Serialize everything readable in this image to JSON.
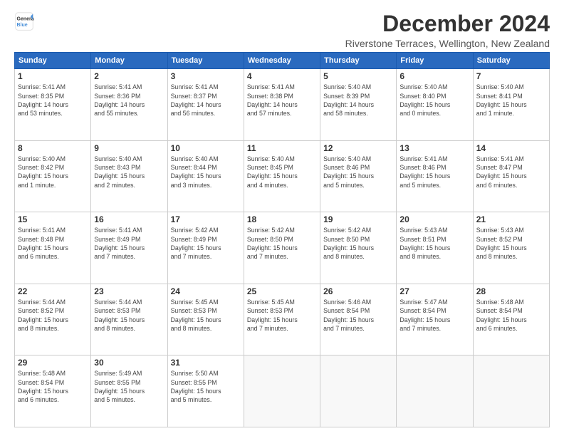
{
  "logo": {
    "line1": "General",
    "line2": "Blue"
  },
  "title": "December 2024",
  "subtitle": "Riverstone Terraces, Wellington, New Zealand",
  "weekdays": [
    "Sunday",
    "Monday",
    "Tuesday",
    "Wednesday",
    "Thursday",
    "Friday",
    "Saturday"
  ],
  "weeks": [
    [
      {
        "day": "1",
        "info": "Sunrise: 5:41 AM\nSunset: 8:35 PM\nDaylight: 14 hours\nand 53 minutes."
      },
      {
        "day": "2",
        "info": "Sunrise: 5:41 AM\nSunset: 8:36 PM\nDaylight: 14 hours\nand 55 minutes."
      },
      {
        "day": "3",
        "info": "Sunrise: 5:41 AM\nSunset: 8:37 PM\nDaylight: 14 hours\nand 56 minutes."
      },
      {
        "day": "4",
        "info": "Sunrise: 5:41 AM\nSunset: 8:38 PM\nDaylight: 14 hours\nand 57 minutes."
      },
      {
        "day": "5",
        "info": "Sunrise: 5:40 AM\nSunset: 8:39 PM\nDaylight: 14 hours\nand 58 minutes."
      },
      {
        "day": "6",
        "info": "Sunrise: 5:40 AM\nSunset: 8:40 PM\nDaylight: 15 hours\nand 0 minutes."
      },
      {
        "day": "7",
        "info": "Sunrise: 5:40 AM\nSunset: 8:41 PM\nDaylight: 15 hours\nand 1 minute."
      }
    ],
    [
      {
        "day": "8",
        "info": "Sunrise: 5:40 AM\nSunset: 8:42 PM\nDaylight: 15 hours\nand 1 minute."
      },
      {
        "day": "9",
        "info": "Sunrise: 5:40 AM\nSunset: 8:43 PM\nDaylight: 15 hours\nand 2 minutes."
      },
      {
        "day": "10",
        "info": "Sunrise: 5:40 AM\nSunset: 8:44 PM\nDaylight: 15 hours\nand 3 minutes."
      },
      {
        "day": "11",
        "info": "Sunrise: 5:40 AM\nSunset: 8:45 PM\nDaylight: 15 hours\nand 4 minutes."
      },
      {
        "day": "12",
        "info": "Sunrise: 5:40 AM\nSunset: 8:46 PM\nDaylight: 15 hours\nand 5 minutes."
      },
      {
        "day": "13",
        "info": "Sunrise: 5:41 AM\nSunset: 8:46 PM\nDaylight: 15 hours\nand 5 minutes."
      },
      {
        "day": "14",
        "info": "Sunrise: 5:41 AM\nSunset: 8:47 PM\nDaylight: 15 hours\nand 6 minutes."
      }
    ],
    [
      {
        "day": "15",
        "info": "Sunrise: 5:41 AM\nSunset: 8:48 PM\nDaylight: 15 hours\nand 6 minutes."
      },
      {
        "day": "16",
        "info": "Sunrise: 5:41 AM\nSunset: 8:49 PM\nDaylight: 15 hours\nand 7 minutes."
      },
      {
        "day": "17",
        "info": "Sunrise: 5:42 AM\nSunset: 8:49 PM\nDaylight: 15 hours\nand 7 minutes."
      },
      {
        "day": "18",
        "info": "Sunrise: 5:42 AM\nSunset: 8:50 PM\nDaylight: 15 hours\nand 7 minutes."
      },
      {
        "day": "19",
        "info": "Sunrise: 5:42 AM\nSunset: 8:50 PM\nDaylight: 15 hours\nand 8 minutes."
      },
      {
        "day": "20",
        "info": "Sunrise: 5:43 AM\nSunset: 8:51 PM\nDaylight: 15 hours\nand 8 minutes."
      },
      {
        "day": "21",
        "info": "Sunrise: 5:43 AM\nSunset: 8:52 PM\nDaylight: 15 hours\nand 8 minutes."
      }
    ],
    [
      {
        "day": "22",
        "info": "Sunrise: 5:44 AM\nSunset: 8:52 PM\nDaylight: 15 hours\nand 8 minutes."
      },
      {
        "day": "23",
        "info": "Sunrise: 5:44 AM\nSunset: 8:53 PM\nDaylight: 15 hours\nand 8 minutes."
      },
      {
        "day": "24",
        "info": "Sunrise: 5:45 AM\nSunset: 8:53 PM\nDaylight: 15 hours\nand 8 minutes."
      },
      {
        "day": "25",
        "info": "Sunrise: 5:45 AM\nSunset: 8:53 PM\nDaylight: 15 hours\nand 7 minutes."
      },
      {
        "day": "26",
        "info": "Sunrise: 5:46 AM\nSunset: 8:54 PM\nDaylight: 15 hours\nand 7 minutes."
      },
      {
        "day": "27",
        "info": "Sunrise: 5:47 AM\nSunset: 8:54 PM\nDaylight: 15 hours\nand 7 minutes."
      },
      {
        "day": "28",
        "info": "Sunrise: 5:48 AM\nSunset: 8:54 PM\nDaylight: 15 hours\nand 6 minutes."
      }
    ],
    [
      {
        "day": "29",
        "info": "Sunrise: 5:48 AM\nSunset: 8:54 PM\nDaylight: 15 hours\nand 6 minutes."
      },
      {
        "day": "30",
        "info": "Sunrise: 5:49 AM\nSunset: 8:55 PM\nDaylight: 15 hours\nand 5 minutes."
      },
      {
        "day": "31",
        "info": "Sunrise: 5:50 AM\nSunset: 8:55 PM\nDaylight: 15 hours\nand 5 minutes."
      },
      null,
      null,
      null,
      null
    ]
  ]
}
